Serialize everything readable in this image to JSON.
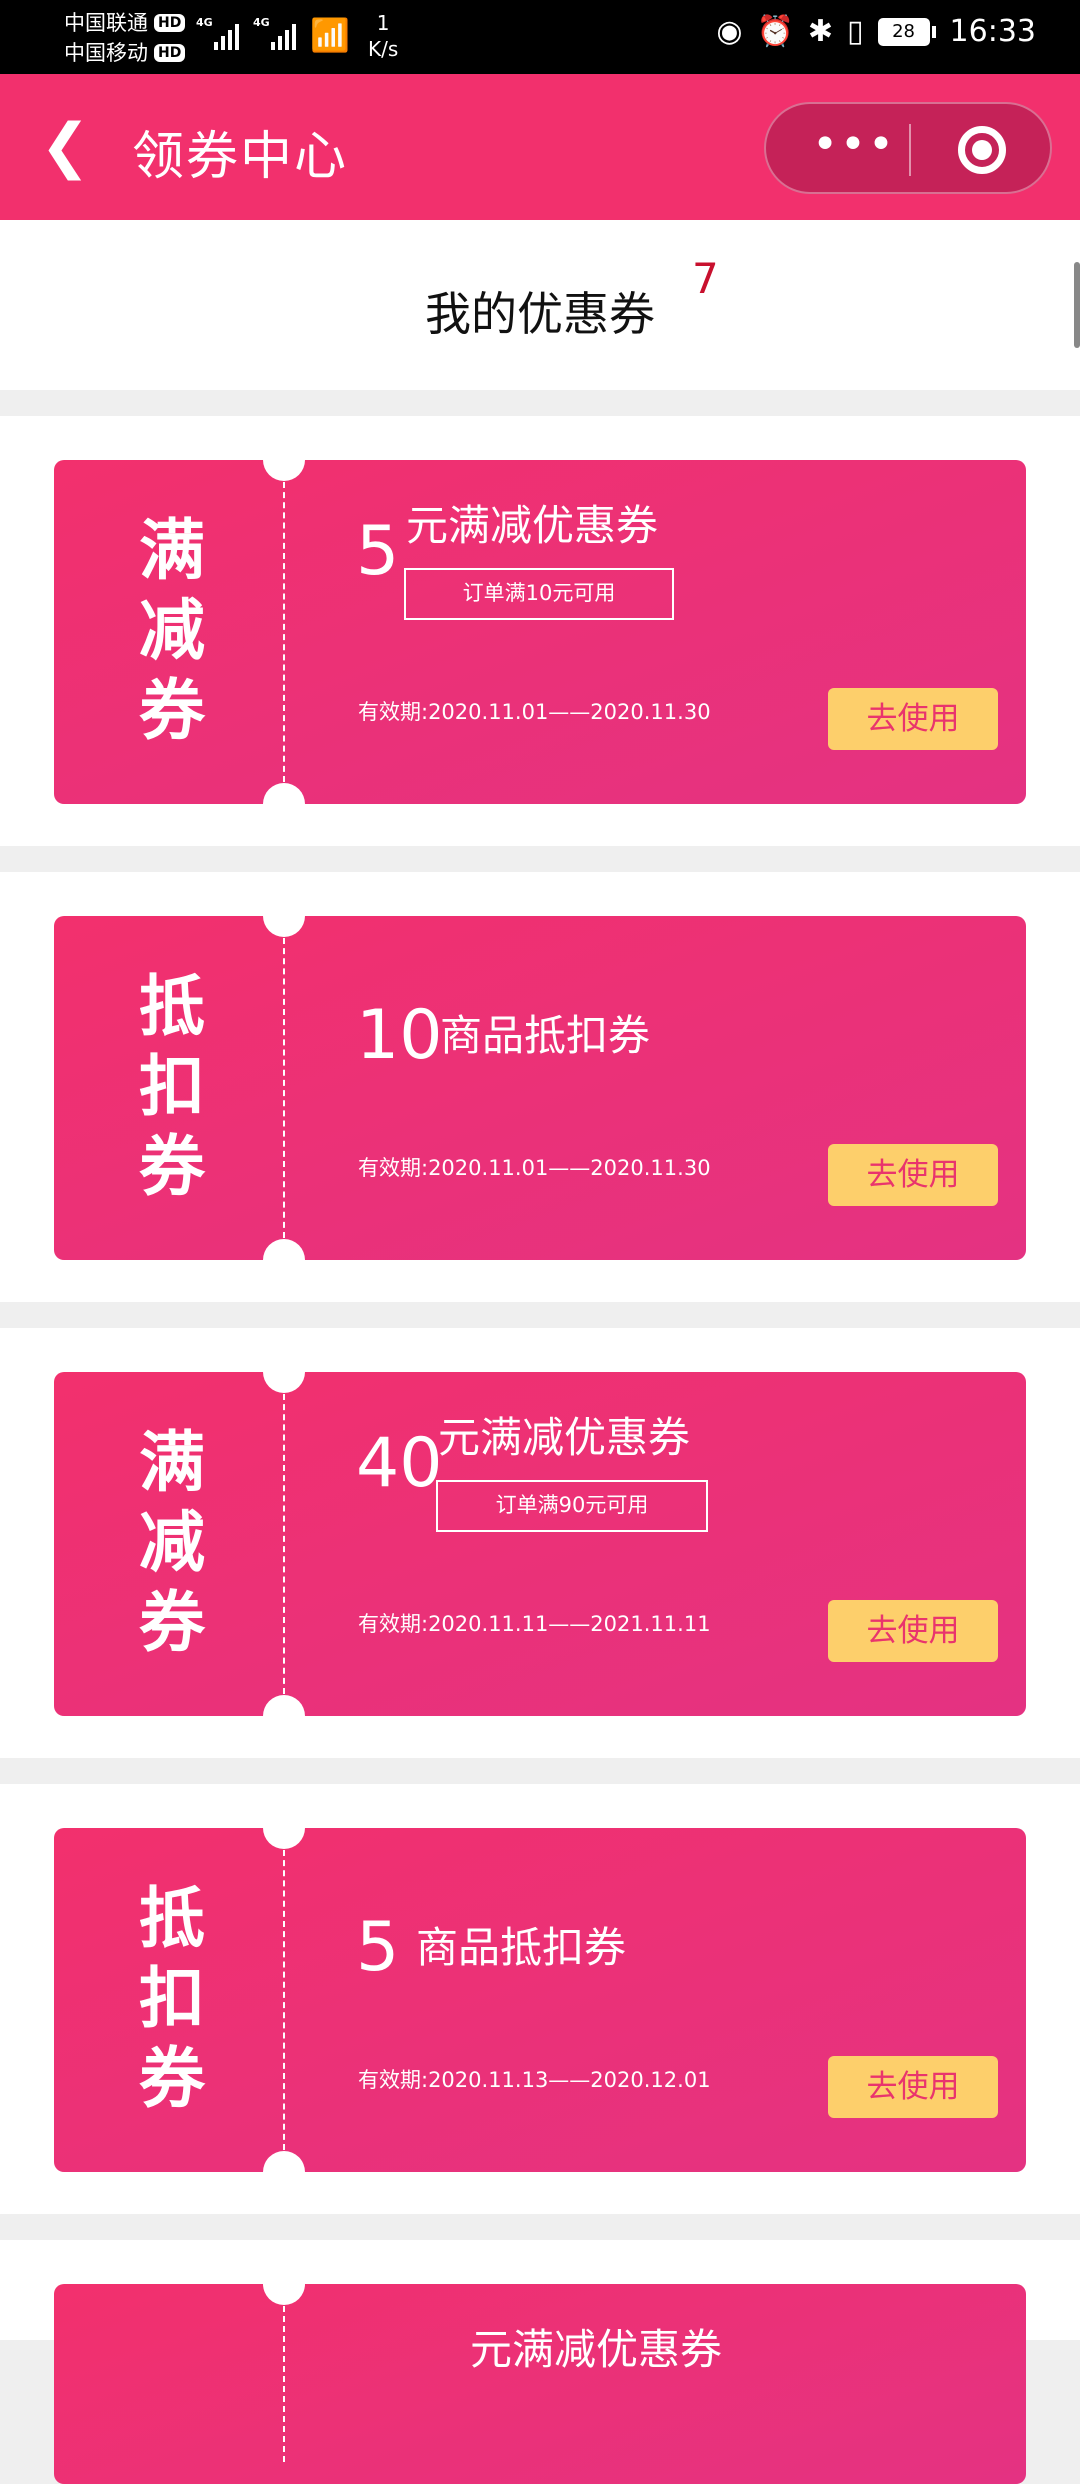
{
  "status_bar": {
    "carrier1": "中国联通",
    "carrier2": "中国移动",
    "hd": "HD",
    "net1": "4G",
    "net2": "4G",
    "speed_value": "1",
    "speed_unit": "K/s",
    "battery": "28",
    "time": "16:33"
  },
  "nav": {
    "back_icon": "chevron-left-icon",
    "title": "领券中心",
    "more_label": "•••",
    "close_icon": "target-icon"
  },
  "header": {
    "title": "我的优惠券",
    "count": "7"
  },
  "coupons": [
    {
      "type_label": "满减券",
      "amount": "5",
      "title": "元满减优惠券",
      "condition": "订单满10元可用",
      "validity": "有效期:2020.11.01——2020.11.30",
      "button": "去使用"
    },
    {
      "type_label": "抵扣券",
      "amount": "10",
      "title": "商品抵扣券",
      "condition": "",
      "validity": "有效期:2020.11.01——2020.11.30",
      "button": "去使用"
    },
    {
      "type_label": "满减券",
      "amount": "40",
      "title": "元满减优惠券",
      "condition": "订单满90元可用",
      "validity": "有效期:2020.11.11——2021.11.11",
      "button": "去使用"
    },
    {
      "type_label": "抵扣券",
      "amount": "5",
      "title": "商品抵扣券",
      "condition": "",
      "validity": "有效期:2020.11.13——2020.12.01",
      "button": "去使用"
    },
    {
      "type_label": "",
      "amount": "",
      "title": "元满减优惠券",
      "condition": "",
      "validity": "",
      "button": ""
    }
  ],
  "colors": {
    "nav": "#f2306d",
    "coupon": "#e43282",
    "button": "#fdcf6b",
    "button_text": "#e9346d",
    "count": "#c8102e"
  }
}
